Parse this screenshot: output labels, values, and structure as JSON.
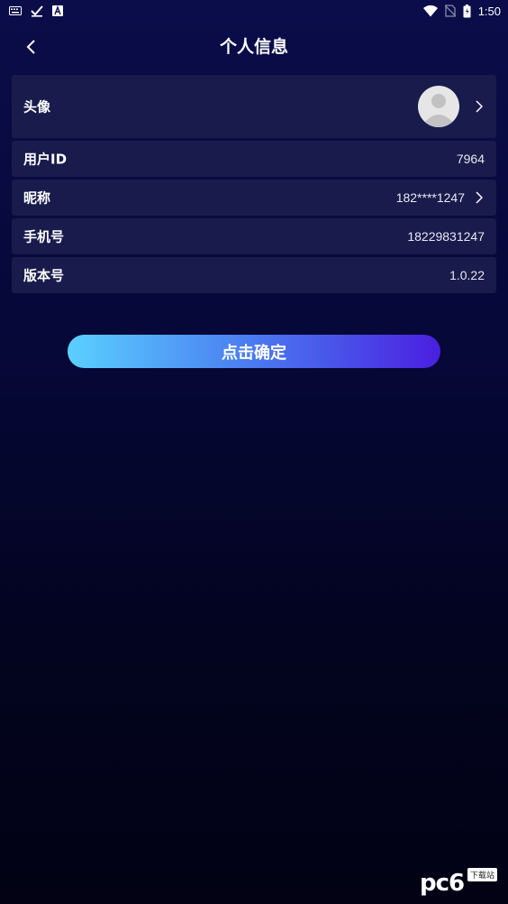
{
  "status_bar": {
    "time": "1:50",
    "left_icons": [
      "keyboard-icon",
      "check-icon",
      "font-icon"
    ],
    "right_icons": [
      "wifi-icon",
      "no-sim-icon",
      "battery-icon"
    ]
  },
  "header": {
    "title": "个人信息",
    "back_icon": "chevron-left-icon"
  },
  "rows": [
    {
      "label": "头像",
      "value": "",
      "type": "avatar",
      "chevron": true
    },
    {
      "label": "用户ID",
      "value": "7964",
      "chevron": false
    },
    {
      "label": "昵称",
      "value": "182****1247",
      "chevron": true
    },
    {
      "label": "手机号",
      "value": "18229831247",
      "chevron": false
    },
    {
      "label": "版本号",
      "value": "1.0.22",
      "chevron": false
    }
  ],
  "confirm_button": {
    "label": "点击确定"
  },
  "watermark": {
    "text": "pc6",
    "tag": "下载站"
  },
  "colors": {
    "background_top": "#0b0d4a",
    "background_bottom": "#020214",
    "row_bg": "#181b4c",
    "button_gradient_start": "#5ad0ff",
    "button_gradient_end": "#4a1fe0"
  }
}
